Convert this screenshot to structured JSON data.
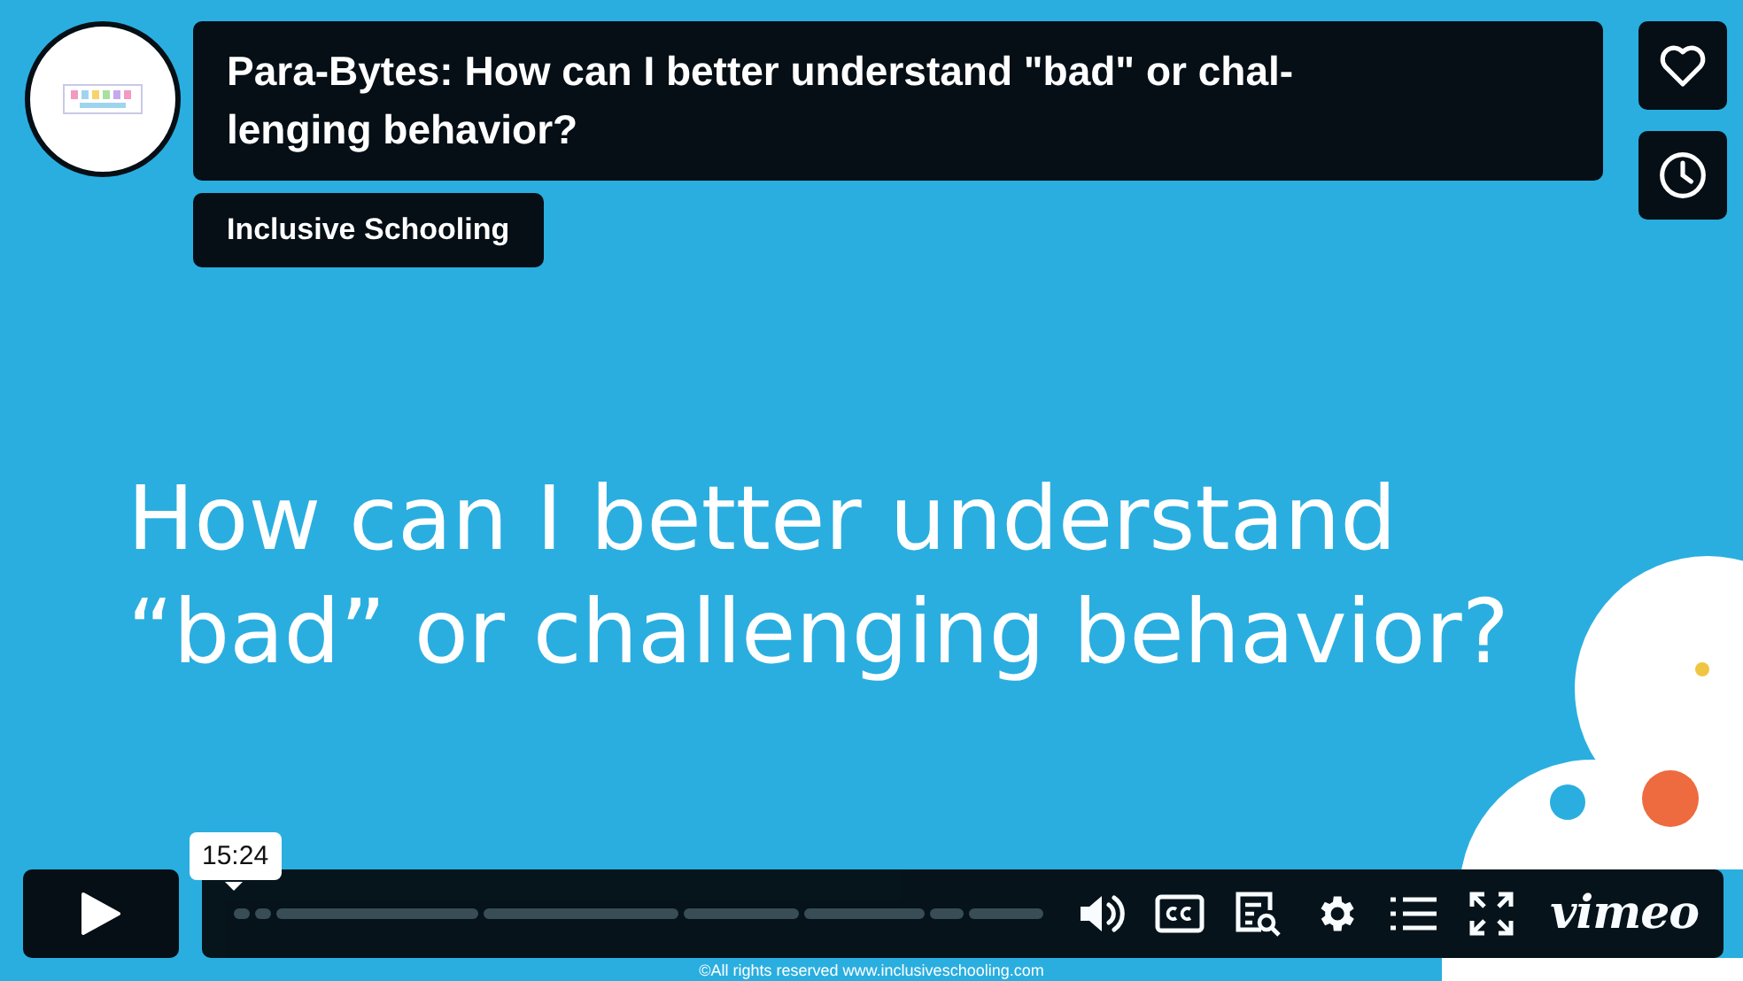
{
  "video": {
    "title": [
      "Para-Bytes: How can I better understand \"bad\" or chal-",
      "lenging behavior?"
    ],
    "byline": "Inclusive Schooling",
    "slide": {
      "heading": [
        "How can I better understand",
        "“bad” or challenging behavior?"
      ],
      "footer": "©All rights reserved www.inclusiveschooling.com"
    },
    "tooltip": "15:24",
    "brand": "vimeo"
  }
}
